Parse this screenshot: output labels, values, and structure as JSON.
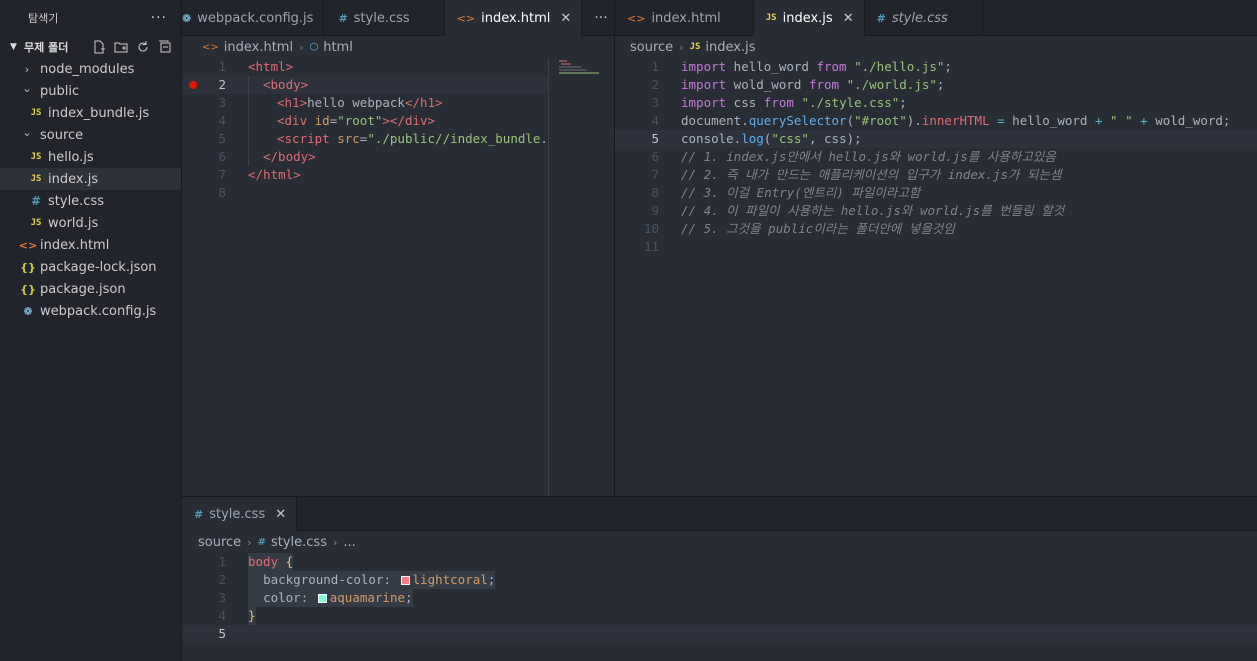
{
  "sidebar": {
    "title": "탐색기",
    "more": "···",
    "folder": "무제 폴더",
    "items": [
      {
        "label": "node_modules",
        "type": "folder-closed",
        "depth": 1
      },
      {
        "label": "public",
        "type": "folder-open",
        "depth": 1
      },
      {
        "label": "index_bundle.js",
        "type": "js",
        "depth": 2
      },
      {
        "label": "source",
        "type": "folder-open",
        "depth": 1
      },
      {
        "label": "hello.js",
        "type": "js",
        "depth": 2
      },
      {
        "label": "index.js",
        "type": "js",
        "depth": 2,
        "active": true
      },
      {
        "label": "style.css",
        "type": "css",
        "depth": 2
      },
      {
        "label": "world.js",
        "type": "js",
        "depth": 2
      },
      {
        "label": "index.html",
        "type": "html",
        "depth": 1
      },
      {
        "label": "package-lock.json",
        "type": "json",
        "depth": 1
      },
      {
        "label": "package.json",
        "type": "json",
        "depth": 1
      },
      {
        "label": "webpack.config.js",
        "type": "webpack",
        "depth": 1
      }
    ]
  },
  "left_group": {
    "tabs": [
      "webpack.config.js",
      "style.css",
      "index.html"
    ],
    "tab_more": "···",
    "breadcrumb": [
      "index.html",
      "html"
    ],
    "breakpoint_line": 2,
    "current_line": 2
  },
  "right_group": {
    "tabs": [
      "index.html",
      "index.js",
      "style.css"
    ],
    "breadcrumb": [
      "source",
      "index.js"
    ],
    "current_line": 5
  },
  "bottom_group": {
    "tab": "style.css",
    "breadcrumb": [
      "source",
      "style.css",
      "..."
    ],
    "current_line": 5
  },
  "icons": {
    "js": "JS",
    "css": "#",
    "html": "<>",
    "json": "{}",
    "close": "✕",
    "chevron_right": "›",
    "chevron_down": "⌄"
  },
  "html_code": [
    [
      [
        "tag",
        "<html>"
      ]
    ],
    [
      [
        "tag",
        "<body>"
      ]
    ],
    [
      [
        "tag",
        "<h1>"
      ],
      [
        "txt",
        "hello webpack"
      ],
      [
        "tag",
        "</h1>"
      ]
    ],
    [
      [
        "tag",
        "<div "
      ],
      [
        "attr",
        "id"
      ],
      [
        "punc",
        "="
      ],
      [
        "str",
        "\"root\""
      ],
      [
        "tag",
        "></div>"
      ]
    ],
    [
      [
        "tag",
        "<script "
      ],
      [
        "attr",
        "src"
      ],
      [
        "punc",
        "="
      ],
      [
        "str",
        "\"./public//index_bundle.js"
      ]
    ],
    [
      [
        "tag",
        "</body>"
      ]
    ],
    [
      [
        "tag",
        "</html>"
      ]
    ],
    []
  ],
  "html_indent": [
    0,
    1,
    2,
    2,
    2,
    1,
    0,
    0
  ],
  "js_code": [
    [
      [
        "kw",
        "import"
      ],
      [
        "txt",
        " hello_word "
      ],
      [
        "kw",
        "from"
      ],
      [
        "txt",
        " "
      ],
      [
        "str",
        "\"./hello.js\""
      ],
      [
        "txt",
        ";"
      ]
    ],
    [
      [
        "kw",
        "import"
      ],
      [
        "txt",
        " wold_word "
      ],
      [
        "kw",
        "from"
      ],
      [
        "txt",
        " "
      ],
      [
        "str",
        "\"./world.js\""
      ],
      [
        "txt",
        ";"
      ]
    ],
    [
      [
        "kw",
        "import"
      ],
      [
        "txt",
        " css "
      ],
      [
        "kw",
        "from"
      ],
      [
        "txt",
        " "
      ],
      [
        "str",
        "\"./style.css\""
      ],
      [
        "txt",
        ";"
      ]
    ],
    [
      [
        "txt",
        "document."
      ],
      [
        "fn",
        "querySelector"
      ],
      [
        "txt",
        "("
      ],
      [
        "str",
        "\"#root\""
      ],
      [
        "txt",
        ")."
      ],
      [
        "tag",
        "innerHTML"
      ],
      [
        "txt",
        " "
      ],
      [
        "op",
        "="
      ],
      [
        "txt",
        " hello_word "
      ],
      [
        "op",
        "+"
      ],
      [
        "txt",
        " "
      ],
      [
        "str",
        "\" \""
      ],
      [
        "txt",
        " "
      ],
      [
        "op",
        "+"
      ],
      [
        "txt",
        " wold_word;"
      ]
    ],
    [
      [
        "txt",
        "console."
      ],
      [
        "fn",
        "log"
      ],
      [
        "txt",
        "("
      ],
      [
        "str",
        "\"css\""
      ],
      [
        "txt",
        ", css);"
      ]
    ],
    [
      [
        "cm",
        "// 1. index.js안에서 hello.js와 world.js를 사용하고있음"
      ]
    ],
    [
      [
        "cm",
        "// 2. 즉 내가 만드는 애플리케이션의 입구가 index.js가 되는셈"
      ]
    ],
    [
      [
        "cm",
        "// 3. 이걸 Entry(엔트리) 파일이라고함"
      ]
    ],
    [
      [
        "cm",
        "// 4. 이 파일이 사용하는 hello.js와 world.js를 번들링 할것"
      ]
    ],
    [
      [
        "cm",
        "// 5. 그것을 public이라는 폴더안에 넣을것임"
      ]
    ],
    []
  ],
  "css_code": [
    [
      [
        "sel",
        "body"
      ],
      [
        "txt",
        " "
      ],
      [
        "brace",
        "{"
      ]
    ],
    [
      [
        "txt",
        "  "
      ],
      [
        "prop",
        "background-color: "
      ],
      [
        "swatch",
        "#f08080"
      ],
      [
        "val",
        "lightcoral"
      ],
      [
        "punc",
        ";"
      ]
    ],
    [
      [
        "txt",
        "  "
      ],
      [
        "prop",
        "color: "
      ],
      [
        "swatch",
        "#7fffd4"
      ],
      [
        "val",
        "aquamarine"
      ],
      [
        "punc",
        ";"
      ]
    ],
    [
      [
        "brace",
        "}"
      ]
    ],
    []
  ]
}
